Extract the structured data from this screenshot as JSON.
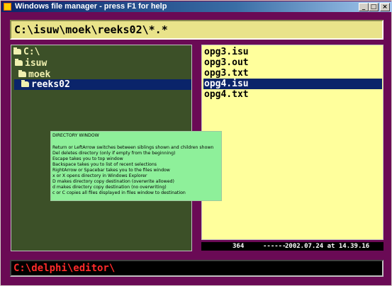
{
  "window": {
    "title": "Windows file manager - press F1 for help",
    "controls": {
      "minimize": "_",
      "maximize": "□",
      "close": "×"
    }
  },
  "path": {
    "value": "C:\\isuw\\moek\\reeks02\\*.*"
  },
  "directories": [
    {
      "label": "C:\\",
      "depth": 0,
      "selected": false
    },
    {
      "label": "isuw",
      "depth": 1,
      "selected": false
    },
    {
      "label": "moek",
      "depth": 2,
      "selected": false
    },
    {
      "label": "reeks02",
      "depth": 3,
      "selected": true
    }
  ],
  "files": [
    {
      "name": "opg3.isu",
      "selected": false
    },
    {
      "name": "opg3.out",
      "selected": false
    },
    {
      "name": "opg3.txt",
      "selected": false
    },
    {
      "name": "opg4.isu",
      "selected": true
    },
    {
      "name": "opg4.txt",
      "selected": false
    }
  ],
  "status": {
    "count": "364",
    "dash": "------",
    "date": "2002.07.24 at 14.39.16"
  },
  "help": {
    "title": "DIRECTORY WINDOW",
    "lines": [
      "Return or LeftArrow switches between siblings shown and children shown",
      "Del deletes directory (only if empty from the beginning)",
      "Escape takes you to top window",
      "Backspace takes you to list of recent selections",
      "RightArrow or Spacebar takes you to the files window",
      "x or X opens directory in Windows Explorer",
      "D makes directory copy destination (overwrite allowed)",
      "d makes directory copy destination (no overwriting)",
      "c or C copies all files displayed in files window to destination"
    ]
  },
  "command": {
    "value": "C:\\delphi\\editor\\"
  },
  "colors": {
    "frame": "#6a0a55",
    "path_bg": "#e9e38a",
    "dir_bg": "#3c5028",
    "file_bg": "#ffff9c",
    "selection": "#0a246a",
    "help_bg": "#8ef09a",
    "command_text": "#ff2a2a"
  }
}
